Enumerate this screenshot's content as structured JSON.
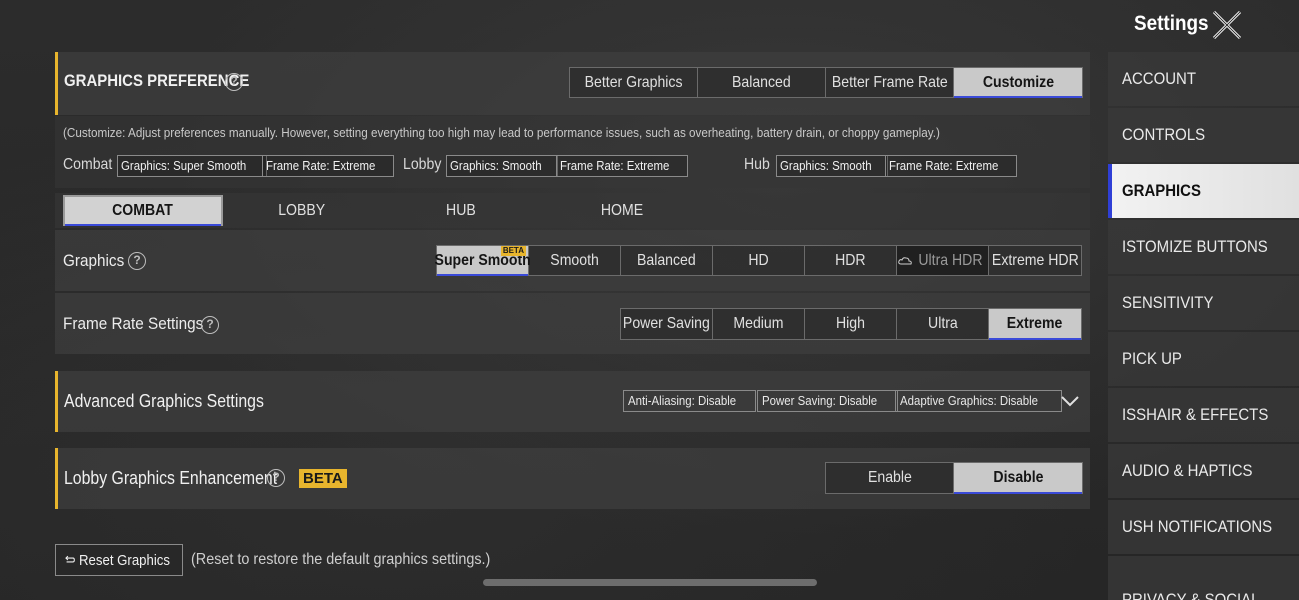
{
  "header": {
    "title": "Settings"
  },
  "preference": {
    "title": "GRAPHICS PREFERENCE",
    "options": [
      "Better Graphics",
      "Balanced",
      "Better Frame Rate",
      "Customize"
    ],
    "selected": "Customize",
    "note": "(Customize: Adjust preferences manually. However, setting everything too high may lead to performance issues, such as overheating, battery drain, or choppy gameplay.)"
  },
  "summary": {
    "combat": {
      "label": "Combat",
      "graphics": "Graphics: Super Smooth",
      "frame": "Frame Rate: Extreme"
    },
    "lobby": {
      "label": "Lobby",
      "graphics": "Graphics: Smooth",
      "frame": "Frame Rate: Extreme"
    },
    "hub": {
      "label": "Hub",
      "graphics": "Graphics: Smooth",
      "frame": "Frame Rate: Extreme"
    }
  },
  "tabs": [
    "COMBAT",
    "LOBBY",
    "HUB",
    "HOME"
  ],
  "graphics": {
    "label": "Graphics",
    "options": [
      "Super Smooth",
      "Smooth",
      "Balanced",
      "HD",
      "HDR",
      "Ultra HDR",
      "Extreme HDR"
    ],
    "selected": "Super Smooth",
    "beta_tag": "BETA"
  },
  "frame_rate": {
    "label": "Frame Rate Settings",
    "options": [
      "Power Saving",
      "Medium",
      "High",
      "Ultra",
      "Extreme"
    ],
    "selected": "Extreme"
  },
  "advanced": {
    "title": "Advanced Graphics Settings",
    "chips": [
      "Anti-Aliasing: Disable",
      "Power Saving: Disable",
      "Adaptive Graphics: Disable"
    ]
  },
  "lobby_enhancement": {
    "title": "Lobby Graphics Enhancement",
    "badge": "BETA",
    "options": [
      "Enable",
      "Disable"
    ],
    "selected": "Disable"
  },
  "reset": {
    "label": "Reset Graphics",
    "note": "(Reset to restore the default graphics settings.)"
  },
  "side_menu": [
    "ACCOUNT",
    "CONTROLS",
    "GRAPHICS",
    "ISTOMIZE BUTTONS",
    "SENSITIVITY",
    "PICK UP",
    "ISSHAIR & EFFECTS",
    "AUDIO & HAPTICS",
    "USH NOTIFICATIONS",
    "PRIVACY & SOCIAL"
  ],
  "colors": {
    "accent_yellow": "#e8b52d",
    "accent_blue": "#3a4ad8"
  }
}
